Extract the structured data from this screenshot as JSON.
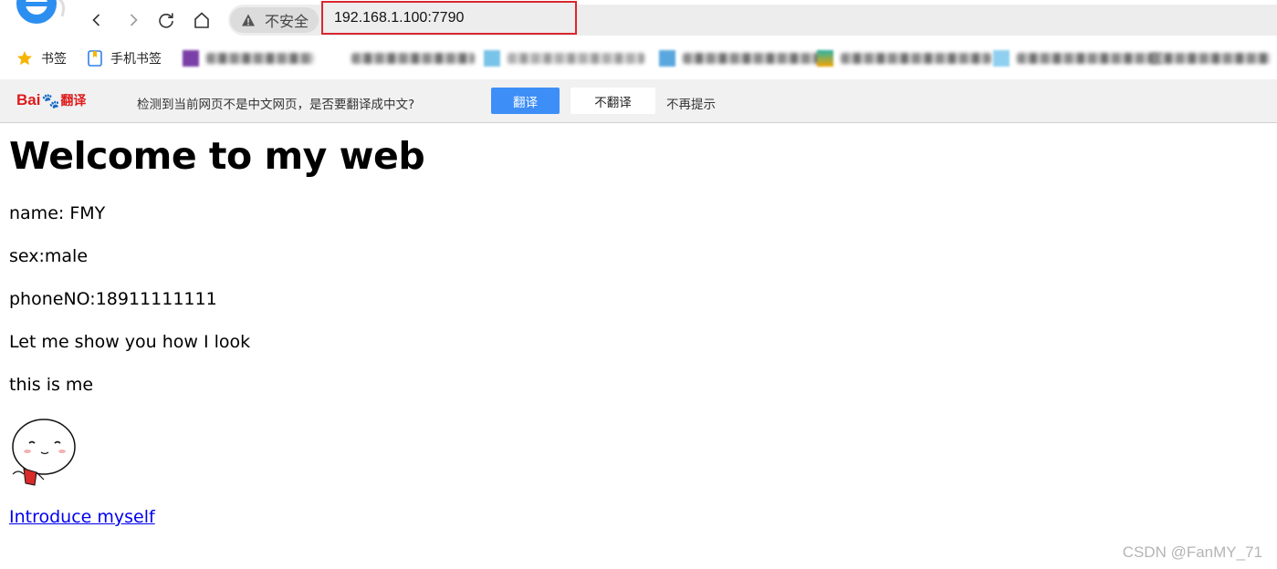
{
  "browser": {
    "address": {
      "security_label": "不安全",
      "url": "192.168.1.100:7790"
    },
    "bookmarks": [
      {
        "label": "书签",
        "icon": "star-icon"
      },
      {
        "label": "手机书签",
        "icon": "mobile-bookmark-icon"
      }
    ],
    "translate_bar": {
      "logo_text": "Bai",
      "logo_suffix": "翻译",
      "message": "检测到当前网页不是中文网页，是否要翻译成中文?",
      "translate_button": "翻译",
      "no_translate_button": "不翻译",
      "no_remind": "不再提示"
    }
  },
  "page": {
    "heading": "Welcome to my web",
    "name_line": "name: FMY",
    "sex_line": "sex:male",
    "phone_line": "phoneNO:18911111111",
    "show_line": "Let me show you how I look",
    "me_line": "this is me",
    "link_text": "Introduce myself"
  },
  "watermark": "CSDN @FanMY_71",
  "colors": {
    "translate_button": "#3e8ef7",
    "url_highlight": "#d9272e",
    "link": "#0000ee"
  }
}
